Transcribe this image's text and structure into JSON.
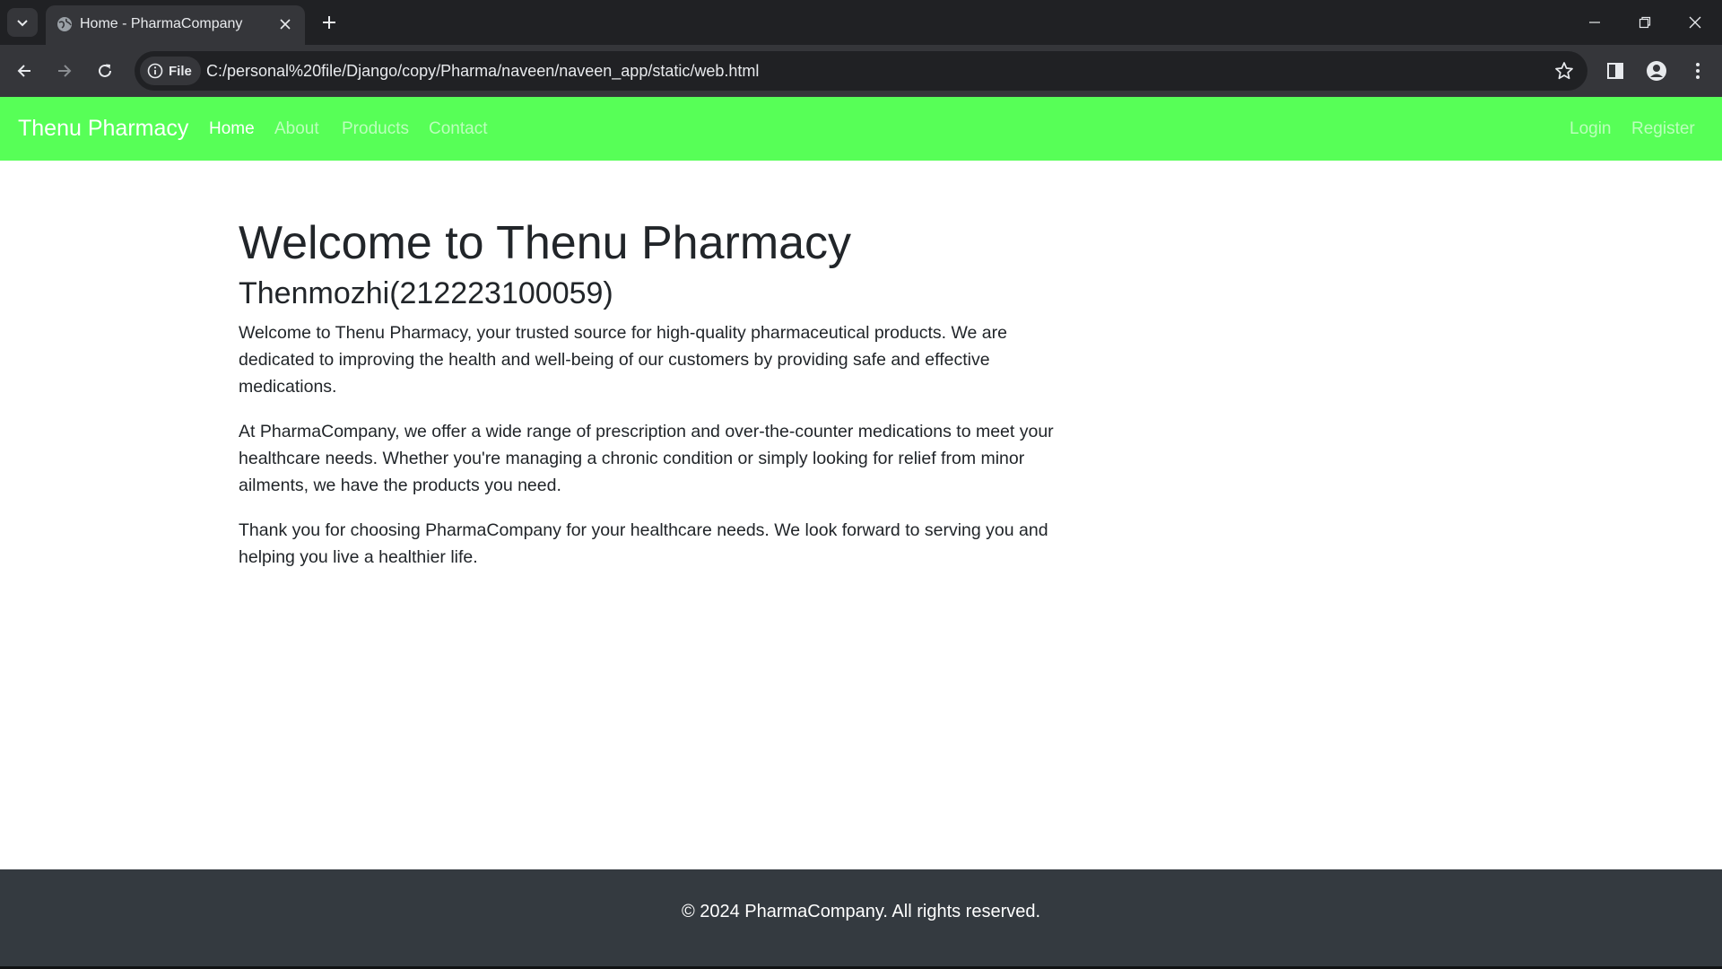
{
  "browser": {
    "tab_title": "Home - PharmaCompany",
    "url": "C:/personal%20file/Django/copy/Pharma/naveen/naveen_app/static/web.html",
    "site_chip_label": "File"
  },
  "navbar": {
    "brand": "Thenu Pharmacy",
    "links": [
      "Home",
      "About",
      "Products",
      "Contact"
    ],
    "active_link": "Home",
    "right_links": [
      "Login",
      "Register"
    ],
    "background_color": "#57ff57"
  },
  "main": {
    "heading": "Welcome to Thenu Pharmacy",
    "subheading": "Thenmozhi(212223100059)",
    "paragraphs": [
      "Welcome to Thenu Pharmacy, your trusted source for high-quality pharmaceutical products. We are dedicated to improving the health and well-being of our customers by providing safe and effective medications.",
      "At PharmaCompany, we offer a wide range of prescription and over-the-counter medications to meet your healthcare needs. Whether you're managing a chronic condition or simply looking for relief from minor ailments, we have the products you need.",
      "Thank you for choosing PharmaCompany for your healthcare needs. We look forward to serving you and helping you live a healthier life."
    ]
  },
  "footer": {
    "text": "© 2024 PharmaCompany. All rights reserved.",
    "background_color": "#343a40"
  },
  "icons": [
    "tab-list-icon",
    "globe-icon",
    "close-icon",
    "plus-icon",
    "minimize-icon",
    "restore-icon",
    "window-close-icon",
    "back-arrow-icon",
    "forward-arrow-icon",
    "reload-icon",
    "info-icon",
    "star-icon",
    "side-panel-icon",
    "profile-icon",
    "kebab-menu-icon"
  ]
}
